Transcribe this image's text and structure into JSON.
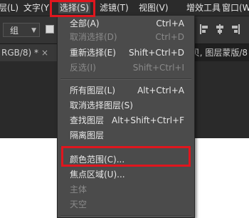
{
  "menubar": {
    "items": [
      {
        "label": "层(L)"
      },
      {
        "label": "文字(Y)"
      },
      {
        "label": "选择(S)"
      },
      {
        "label": "滤镜(T)"
      },
      {
        "label": "视图(V)"
      },
      {
        "label": "增效工具"
      },
      {
        "label": "窗口(W)"
      }
    ]
  },
  "options": {
    "group_select": "组"
  },
  "tabs": {
    "left_label": "RGB/8) *",
    "close_label": "×",
    "right_label": "贝, 图层蒙版/8"
  },
  "dropdown": {
    "items": [
      {
        "label": "全部(A)",
        "shortcut": "Ctrl+A",
        "enabled": true
      },
      {
        "label": "取消选择(D)",
        "shortcut": "Ctrl+D",
        "enabled": false
      },
      {
        "label": "重新选择(E)",
        "shortcut": "Shift+Ctrl+D",
        "enabled": true
      },
      {
        "label": "反选(I)",
        "shortcut": "Shift+Ctrl+I",
        "enabled": false
      },
      {
        "label": "所有图层(L)",
        "shortcut": "Alt+Ctrl+A",
        "enabled": true
      },
      {
        "label": "取消选择图层(S)",
        "shortcut": "",
        "enabled": true
      },
      {
        "label": "查找图层",
        "shortcut": "Alt+Shift+Ctrl+F",
        "enabled": true
      },
      {
        "label": "隔离图层",
        "shortcut": "",
        "enabled": true
      },
      {
        "label": "颜色范围(C)...",
        "shortcut": "",
        "enabled": true
      },
      {
        "label": "焦点区域(U)...",
        "shortcut": "",
        "enabled": true
      },
      {
        "label": "主体",
        "shortcut": "",
        "enabled": false
      },
      {
        "label": "天空",
        "shortcut": "",
        "enabled": false
      }
    ]
  },
  "colors": {
    "highlight": "#e0161e",
    "menu_bg": "#4b4b4b"
  }
}
